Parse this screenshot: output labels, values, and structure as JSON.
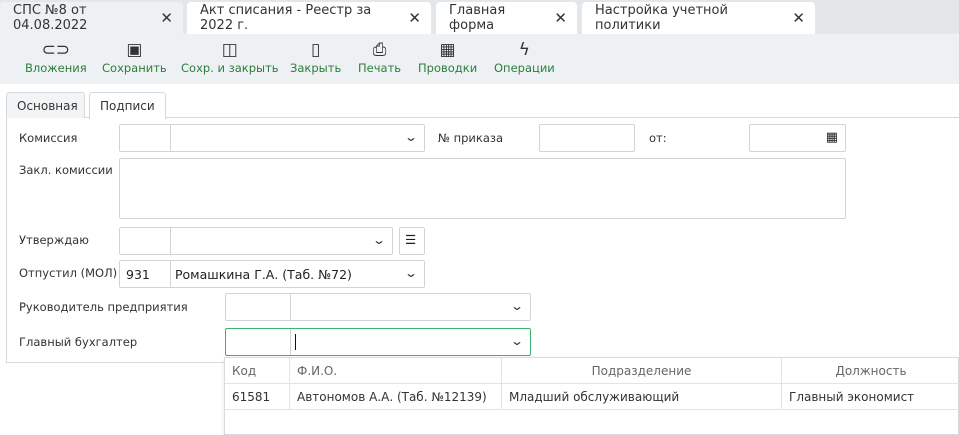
{
  "doc_tabs": [
    {
      "label": "СПС №8 от 04.08.2022",
      "active": true
    },
    {
      "label": "Акт списания - Реестр за 2022 г."
    },
    {
      "label": "Главная форма"
    },
    {
      "label": "Настройка учетной политики"
    }
  ],
  "toolbar": [
    {
      "label": "Вложения",
      "icon": "paperclip-icon"
    },
    {
      "label": "Сохранить",
      "icon": "save-icon"
    },
    {
      "label": "Сохр. и закрыть",
      "icon": "save-close-icon"
    },
    {
      "label": "Закрыть",
      "icon": "door-icon"
    },
    {
      "label": "Печать",
      "icon": "printer-icon"
    },
    {
      "label": "Проводки",
      "icon": "calculator-icon"
    },
    {
      "label": "Операции",
      "icon": "lightning-icon"
    }
  ],
  "form_tabs": [
    {
      "label": "Основная"
    },
    {
      "label": "Подписи",
      "active": true
    }
  ],
  "form": {
    "commission_label": "Комиссия",
    "order_label": "№ приказа",
    "from_label": "от:",
    "conclusion_label": "Закл. комиссии",
    "approve_label": "Утверждаю",
    "released_label": "Отпустил (МОЛ)",
    "released_code": "931",
    "released_name": "Ромашкина Г.А. (Таб. №72)",
    "head_label": "Руководитель предприятия",
    "accountant_label": "Главный бухгалтер"
  },
  "dropdown": {
    "columns": [
      "Код",
      "Ф.И.О.",
      "Подразделение",
      "Должность"
    ],
    "rows": [
      [
        "61581",
        "Автономов А.А. (Таб. №12139)",
        "Младший обслуживающий",
        "Главный экономист"
      ]
    ]
  },
  "colors": {
    "accent": "#2d7d3a",
    "focus_border": "#3cb371"
  }
}
